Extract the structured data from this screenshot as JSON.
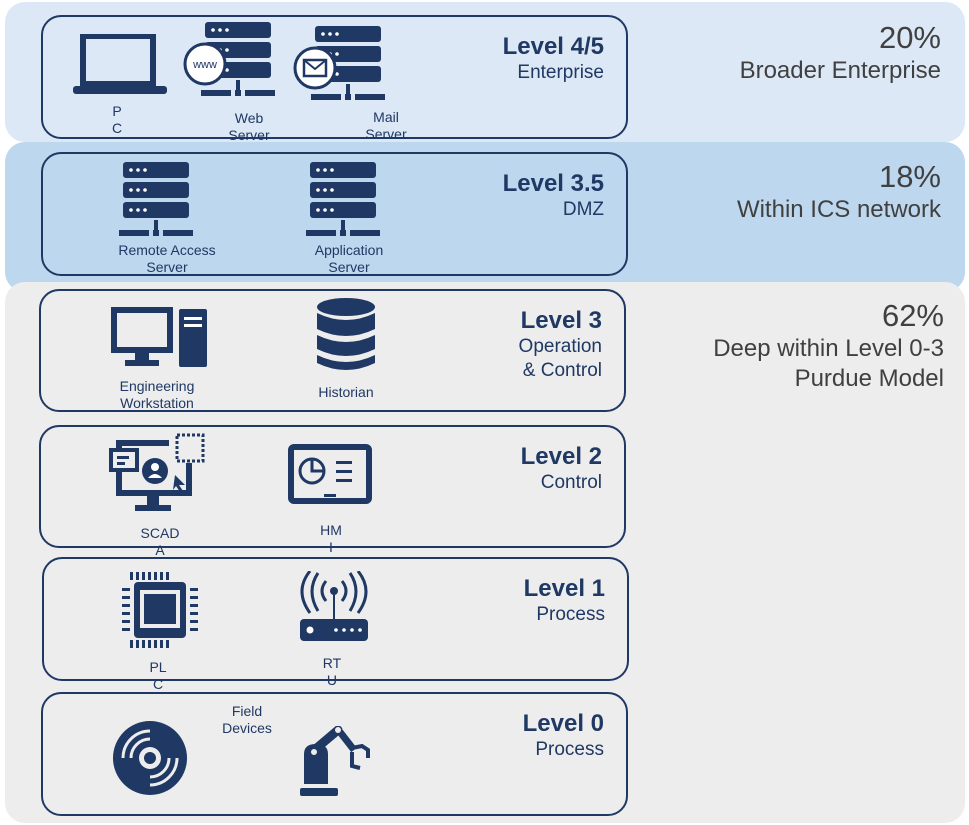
{
  "colors": {
    "navy": "#1f3864",
    "band_enterprise": "#dce8f5",
    "band_dmz": "#bdd7ee",
    "band_ics": "#ededed",
    "percent_text": "#404040"
  },
  "bands": [
    {
      "percent": "20%",
      "desc": [
        "Broader Enterprise"
      ]
    },
    {
      "percent": "18%",
      "desc": [
        "Within ICS network"
      ]
    },
    {
      "percent": "62%",
      "desc": [
        "Deep within Level 0-3",
        "Purdue Model"
      ]
    }
  ],
  "levels": [
    {
      "title": "Level 4/5",
      "subtitle": [
        "Enterprise"
      ],
      "devices": [
        {
          "icon": "laptop-icon",
          "label": [
            "P",
            "C"
          ]
        },
        {
          "icon": "web-server-icon",
          "label": [
            "Web",
            "Server"
          ]
        },
        {
          "icon": "mail-server-icon",
          "label": [
            "Mail",
            "Server"
          ]
        }
      ]
    },
    {
      "title": "Level 3.5",
      "subtitle": [
        "DMZ"
      ],
      "devices": [
        {
          "icon": "server-icon",
          "label": [
            "Remote Access",
            "Server"
          ]
        },
        {
          "icon": "server-icon",
          "label": [
            "Application",
            "Server"
          ]
        }
      ]
    },
    {
      "title": "Level 3",
      "subtitle": [
        "Operation",
        "& Control"
      ],
      "devices": [
        {
          "icon": "workstation-icon",
          "label": [
            "Engineering",
            "Workstation"
          ]
        },
        {
          "icon": "database-icon",
          "label": [
            "Historian"
          ]
        }
      ]
    },
    {
      "title": "Level 2",
      "subtitle": [
        "Control"
      ],
      "devices": [
        {
          "icon": "scada-monitor-icon",
          "label": [
            "SCAD",
            "A"
          ]
        },
        {
          "icon": "hmi-tablet-icon",
          "label": [
            "HM",
            "I"
          ]
        }
      ]
    },
    {
      "title": "Level 1",
      "subtitle": [
        "Process"
      ],
      "devices": [
        {
          "icon": "chip-icon",
          "label": [
            "PL",
            "C"
          ]
        },
        {
          "icon": "rtu-router-icon",
          "label": [
            "RT",
            "U"
          ]
        }
      ]
    },
    {
      "title": "Level 0",
      "subtitle": [
        "Process"
      ],
      "devices": [
        {
          "icon": "disk-icon",
          "label": []
        },
        {
          "icon": "robot-arm-icon",
          "label": []
        }
      ],
      "group_label": [
        "Field",
        "Devices"
      ]
    }
  ]
}
